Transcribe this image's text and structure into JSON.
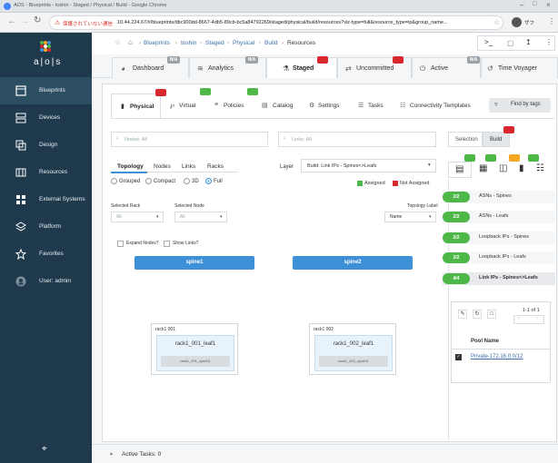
{
  "browser": {
    "title": "AOS - Blueprints - toshin - Staged / Physical / Build - Google Chrome",
    "insecure_label": "保護されていない通信",
    "url": "10.44.224.67/#/blueprints/dbc900dd-8667-4db5-89cb-bc5a84792269/staged/physical/build/resources?viz-type=full&resource_type=ip&group_name...",
    "profile_label": "ザフ"
  },
  "brand": {
    "name": "a|o|s"
  },
  "sidebar": {
    "items": [
      {
        "label": "Blueprints",
        "icon": "blueprints-icon",
        "active": true
      },
      {
        "label": "Devices",
        "icon": "devices-icon"
      },
      {
        "label": "Design",
        "icon": "design-icon"
      },
      {
        "label": "Resources",
        "icon": "resources-icon"
      },
      {
        "label": "External Systems",
        "icon": "external-systems-icon"
      },
      {
        "label": "Platform",
        "icon": "platform-icon"
      },
      {
        "label": "Favorites",
        "icon": "star-icon"
      },
      {
        "label": "User: admin",
        "icon": "user-icon"
      }
    ]
  },
  "breadcrumb": [
    "Blueprints",
    "toshin",
    "Staged",
    "Physical",
    "Build",
    "Resources"
  ],
  "main_tabs": [
    {
      "label": "Dashboard",
      "badge": "N/A"
    },
    {
      "label": "Analytics",
      "badge": "N/A"
    },
    {
      "label": "Staged",
      "badge": "red",
      "active": true
    },
    {
      "label": "Uncommitted",
      "badge": "red"
    },
    {
      "label": "Active",
      "badge": "N/A"
    },
    {
      "label": "Time Voyager",
      "badge": ""
    }
  ],
  "sub_tabs": [
    {
      "label": "Physical",
      "badge": "red",
      "active": true
    },
    {
      "label": "Virtual",
      "badge": "green"
    },
    {
      "label": "Policies",
      "badge": "green"
    },
    {
      "label": "Catalog",
      "badge": ""
    },
    {
      "label": "Settings",
      "badge": ""
    },
    {
      "label": "Tasks",
      "badge": ""
    },
    {
      "label": "Connectivity Templates",
      "badge": ""
    }
  ],
  "find_by_tags": "Find by tags",
  "filters": {
    "nodes": "Nodes: All",
    "links": "Links: All"
  },
  "side_tabs": {
    "selection": "Selection",
    "build": "Build"
  },
  "view_tabs": [
    "Topology",
    "Nodes",
    "Links",
    "Racks"
  ],
  "layer": {
    "label": "Layer",
    "value": "Build: Link IPs - Spines<>Leafs"
  },
  "legend": {
    "assigned": "Assigned",
    "not_assigned": "Not Assigned"
  },
  "view_modes": [
    {
      "label": "Grouped",
      "on": false
    },
    {
      "label": "Compact",
      "on": false
    },
    {
      "label": "3D",
      "on": false
    },
    {
      "label": "Full",
      "on": true
    }
  ],
  "selects": {
    "rack_label": "Selected Rack",
    "rack_value": "All",
    "node_label": "Selected Node",
    "node_value": "All",
    "topo_label": "Topology Label",
    "topo_value": "Name"
  },
  "checks": {
    "expand": "Expand Nodes?",
    "show_links": "Show Links?"
  },
  "spines": [
    "spine1",
    "spine2"
  ],
  "racks": [
    {
      "name": "rack1 001",
      "leaf": "rack1_001_leaf1",
      "sys": "rack1_001_sys001"
    },
    {
      "name": "rack1 002",
      "leaf": "rack1_002_leaf1",
      "sys": "rack1_002_sys001"
    }
  ],
  "resources": [
    {
      "count": "2/2",
      "label": "ASNs - Spines"
    },
    {
      "count": "2/2",
      "label": "ASNs - Leafs"
    },
    {
      "count": "2/2",
      "label": "Loopback IPs - Spines"
    },
    {
      "count": "2/2",
      "label": "Loopback IPs - Leafs"
    },
    {
      "count": "4/4",
      "label": "Link IPs - Spines<>Leafs"
    }
  ],
  "pager": "1-1 of 1",
  "pool": {
    "header": "Pool Name",
    "value": "Private-172.16.0.0/12"
  },
  "footer": {
    "tasks": "Active Tasks: 0"
  },
  "colors": {
    "sidebar": "#1e3a4c",
    "accent": "#3d8fd6",
    "red": "#d9272e",
    "green": "#4db848"
  }
}
